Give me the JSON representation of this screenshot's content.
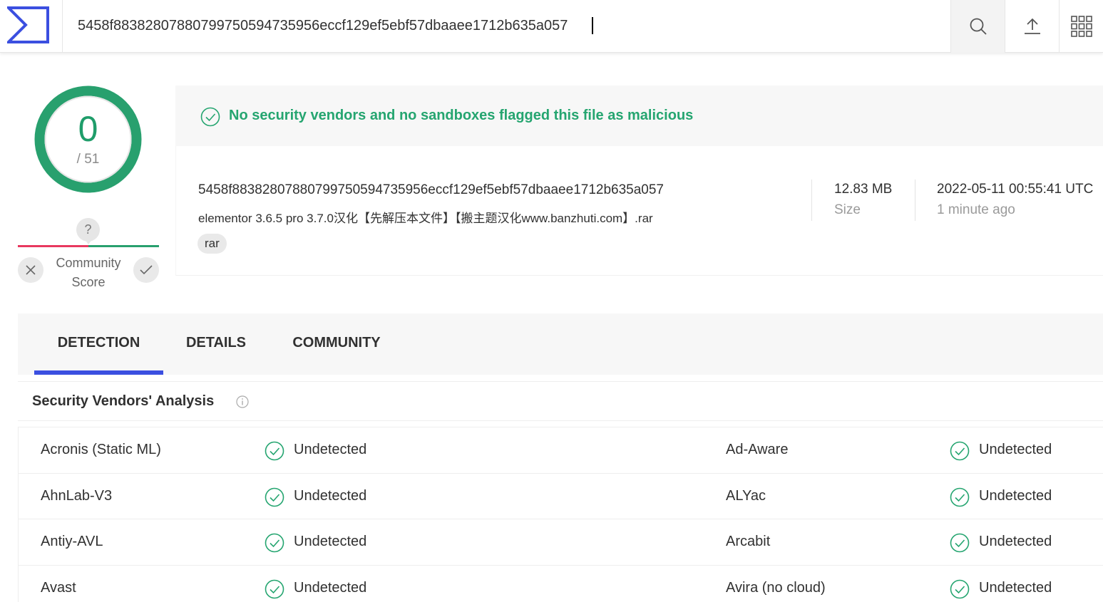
{
  "header": {
    "logo_icon": "virustotal-logo",
    "search_value": "5458f88382807880799750594735956eccf129ef5ebf57dbaaee1712b635a057",
    "buttons": [
      "search-icon",
      "upload-icon",
      "apps-grid-icon"
    ]
  },
  "score": {
    "detections": "0",
    "total": "/ 51"
  },
  "community_score": {
    "marker": "?",
    "label_line1": "Community",
    "label_line2": "Score"
  },
  "banner": {
    "message": "No security vendors and no sandboxes flagged this file as malicious"
  },
  "file": {
    "hash": "5458f88382807880799750594735956eccf129ef5ebf57dbaaee1712b635a057",
    "name": "elementor 3.6.5 pro 3.7.0汉化【先解压本文件】【搬主题汉化www.banzhuti.com】.rar",
    "tag": "rar",
    "size_value": "12.83 MB",
    "size_label": "Size",
    "date_value": "2022-05-11 00:55:41 UTC",
    "date_ago": "1 minute ago"
  },
  "tabs": [
    {
      "label": "DETECTION",
      "active": true
    },
    {
      "label": "DETAILS",
      "active": false
    },
    {
      "label": "COMMUNITY",
      "active": false
    }
  ],
  "section": {
    "title": "Security Vendors' Analysis"
  },
  "vendors": [
    {
      "left_name": "Acronis (Static ML)",
      "left_result": "Undetected",
      "right_name": "Ad-Aware",
      "right_result": "Undetected"
    },
    {
      "left_name": "AhnLab-V3",
      "left_result": "Undetected",
      "right_name": "ALYac",
      "right_result": "Undetected"
    },
    {
      "left_name": "Antiy-AVL",
      "left_result": "Undetected",
      "right_name": "Arcabit",
      "right_result": "Undetected"
    },
    {
      "left_name": "Avast",
      "left_result": "Undetected",
      "right_name": "Avira (no cloud)",
      "right_result": "Undetected"
    }
  ],
  "colors": {
    "accent_blue": "#3b4fe0",
    "clean_green": "#25a570",
    "ring_green": "#1f9d6a",
    "community_red": "#e8385f"
  }
}
